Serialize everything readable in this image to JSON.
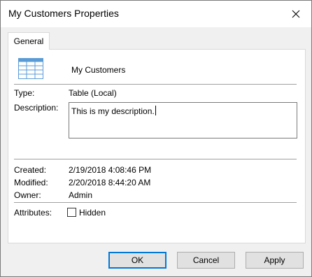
{
  "window": {
    "title": "My Customers Properties"
  },
  "tabs": [
    {
      "label": "General"
    }
  ],
  "general": {
    "object_name": "My Customers",
    "type_label": "Type:",
    "type_value": "Table (Local)",
    "description_label": "Description:",
    "description_value": "This is my description.",
    "created_label": "Created:",
    "created_value": "2/19/2018 4:08:46 PM",
    "modified_label": "Modified:",
    "modified_value": "2/20/2018 8:44:20 AM",
    "owner_label": "Owner:",
    "owner_value": "Admin",
    "attributes_label": "Attributes:",
    "hidden_label": "Hidden",
    "hidden_checked": false
  },
  "buttons": {
    "ok": "OK",
    "cancel": "Cancel",
    "apply": "Apply"
  },
  "icons": {
    "close": "close-icon",
    "table": "table-icon"
  },
  "colors": {
    "default_button_border": "#0078d7",
    "table_icon_blue": "#5b9bd5"
  }
}
